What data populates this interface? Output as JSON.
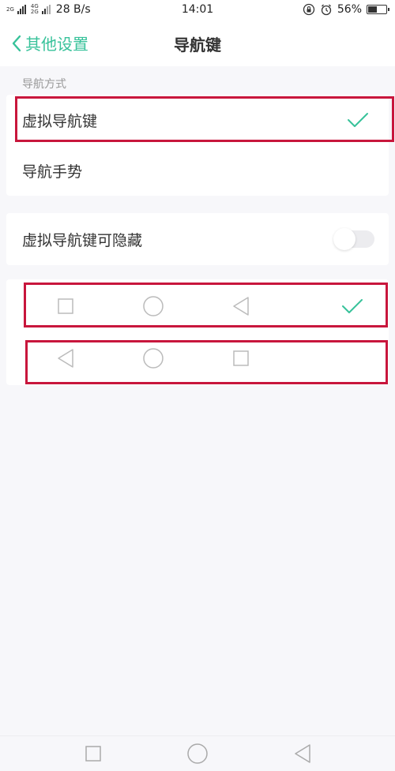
{
  "status_bar": {
    "sim1": "2G",
    "sim2_top": "4G",
    "sim2_bottom": "2G",
    "speed": "28 B/s",
    "time": "14:01",
    "battery": "56%",
    "battery_level": 0.56
  },
  "header": {
    "back_label": "其他设置",
    "title": "导航键"
  },
  "navigation_mode": {
    "section_label": "导航方式",
    "options": [
      {
        "label": "虚拟导航键",
        "selected": true
      },
      {
        "label": "导航手势",
        "selected": false
      }
    ]
  },
  "hide_toggle": {
    "label": "虚拟导航键可隐藏",
    "enabled": false
  },
  "key_layouts": [
    {
      "icons": [
        "square-icon",
        "circle-icon",
        "back-triangle-icon"
      ],
      "selected": true
    },
    {
      "icons": [
        "back-triangle-icon",
        "circle-icon",
        "square-icon"
      ],
      "selected": false
    }
  ],
  "system_nav": {
    "icons": [
      "square-icon",
      "circle-icon",
      "back-triangle-icon"
    ]
  },
  "colors": {
    "accent": "#37c29a",
    "highlight_box": "#c8163c",
    "background": "#f7f7fa"
  }
}
